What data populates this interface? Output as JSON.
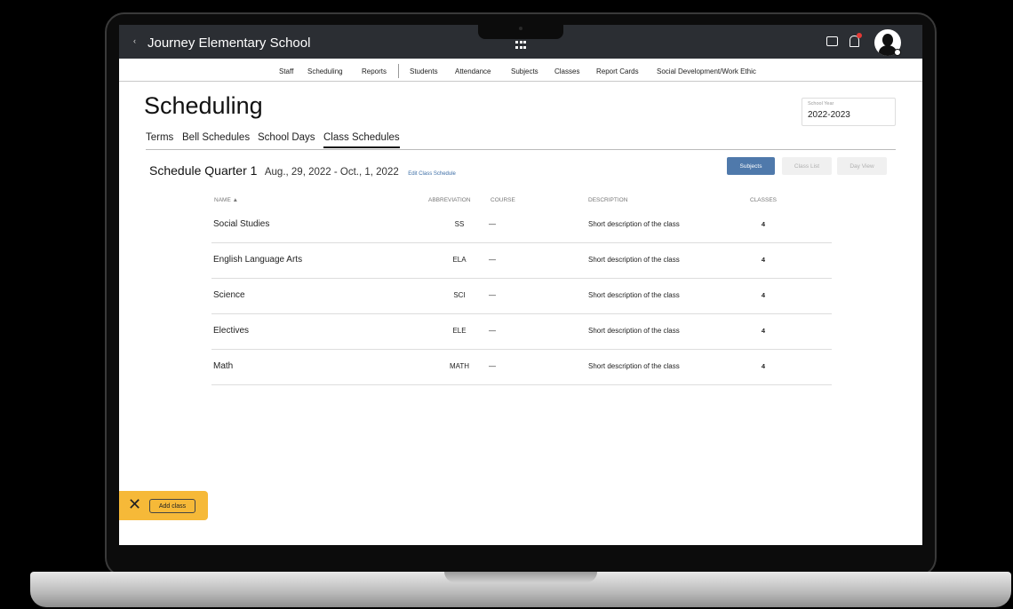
{
  "app": {
    "school_name": "Journey Elementary School",
    "back_glyph": "‹"
  },
  "subnav": {
    "left_items": [
      "Staff",
      "Scheduling",
      "Reports"
    ],
    "right_items": [
      "Students",
      "Attendance",
      "Subjects",
      "Classes",
      "Report Cards",
      "Social Development/Work Ethic"
    ]
  },
  "page": {
    "title": "Scheduling",
    "school_year_label": "School Year",
    "school_year_value": "2022-2023"
  },
  "tabs": [
    "Terms",
    "Bell Schedules",
    "School Days",
    "Class Schedules"
  ],
  "active_tab": "Class Schedules",
  "schedule": {
    "name": "Schedule Quarter 1",
    "dates": "Aug., 29, 2022 - Oct., 1, 2022",
    "edit_link": "Edit Class Schedule"
  },
  "buttons": {
    "subjects": "Subjects",
    "class_list": "Class List",
    "day_view": "Day View"
  },
  "table": {
    "headers": {
      "name": "NAME ▲",
      "abbreviation": "ABBREVIATION",
      "course": "COURSE",
      "description": "DESCRIPTION",
      "classes": "CLASSES"
    },
    "rows": [
      {
        "name": "Social Studies",
        "abbreviation": "SS",
        "course": "—",
        "description": "Short description of the class",
        "classes": "4"
      },
      {
        "name": "English Language Arts",
        "abbreviation": "ELA",
        "course": "—",
        "description": "Short description of the class",
        "classes": "4"
      },
      {
        "name": "Science",
        "abbreviation": "SCI",
        "course": "—",
        "description": "Short description of the class",
        "classes": "4"
      },
      {
        "name": "Electives",
        "abbreviation": "ELE",
        "course": "—",
        "description": "Short description of the class",
        "classes": "4"
      },
      {
        "name": "Math",
        "abbreviation": "MATH",
        "course": "—",
        "description": "Short description of the class",
        "classes": "4"
      }
    ]
  },
  "toast": {
    "close_glyph": "✕",
    "add_label": "Add class"
  },
  "icons": [
    "back-icon",
    "apps-grid-icon",
    "chat-icon",
    "bell-icon",
    "avatar",
    "close-icon"
  ],
  "colors": {
    "topbar": "#2b2e33",
    "primary_button": "#4f79ab",
    "link": "#3d6ea6",
    "toast": "#f6b938",
    "notification": "#e53935"
  }
}
